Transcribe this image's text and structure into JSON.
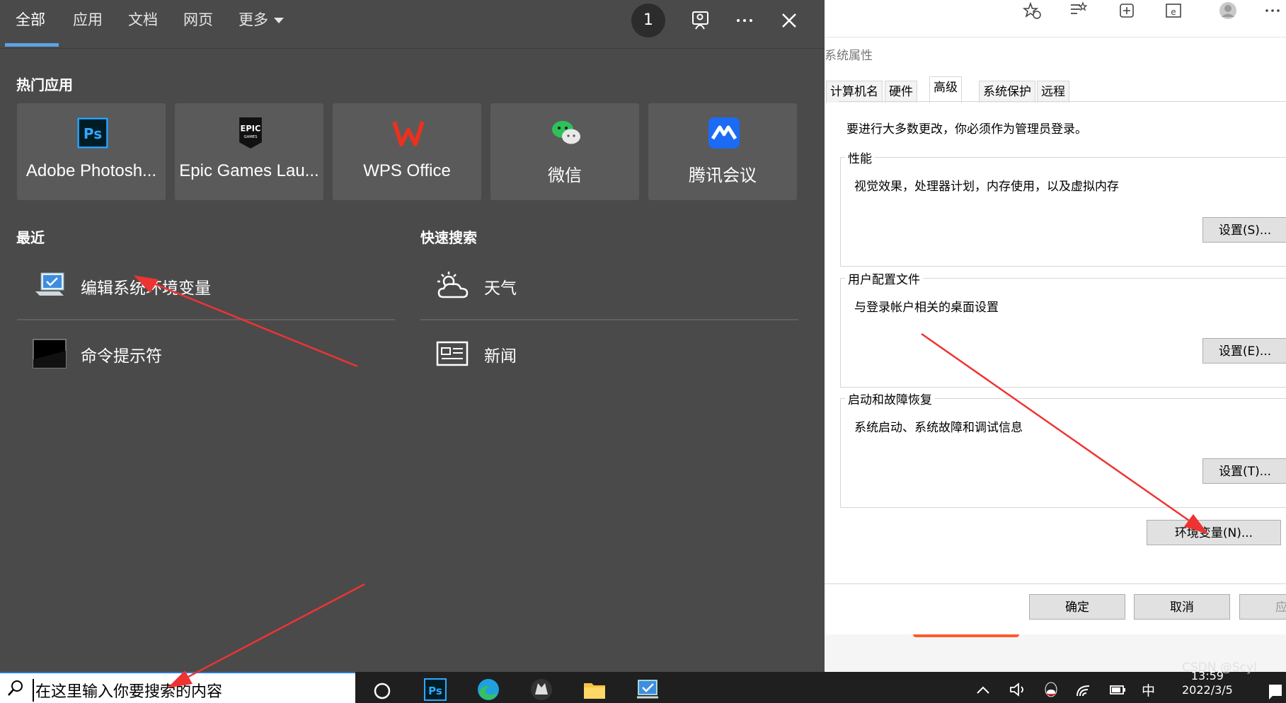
{
  "search": {
    "tabs": [
      {
        "label": "全部"
      },
      {
        "label": "应用"
      },
      {
        "label": "文档"
      },
      {
        "label": "网页"
      },
      {
        "label": "更多"
      }
    ],
    "badge_count": "1",
    "hot_apps_title": "热门应用",
    "hot_apps": [
      {
        "name": "Adobe Photosh...",
        "icon": "photoshop-icon"
      },
      {
        "name": "Epic Games Lau...",
        "icon": "epic-games-icon"
      },
      {
        "name": "WPS Office",
        "icon": "wps-office-icon"
      },
      {
        "name": "微信",
        "icon": "wechat-icon"
      },
      {
        "name": "腾讯会议",
        "icon": "tencent-meeting-icon"
      }
    ],
    "recent_title": "最近",
    "recent": [
      {
        "label": "编辑系统环境变量",
        "icon": "computer-settings-icon"
      },
      {
        "label": "命令提示符",
        "icon": "command-prompt-icon"
      }
    ],
    "quick_title": "快速搜索",
    "quick": [
      {
        "label": "天气",
        "icon": "weather-icon"
      },
      {
        "label": "新闻",
        "icon": "news-icon"
      }
    ]
  },
  "dialog": {
    "title": "系统属性",
    "tabs": [
      "计算机名",
      "硬件",
      "高级",
      "系统保护",
      "远程"
    ],
    "note": "要进行大多数更改，你必须作为管理员登录。",
    "groups": [
      {
        "legend": "性能",
        "desc": "视觉效果，处理器计划，内存使用，以及虚拟内存",
        "button": "设置(S)..."
      },
      {
        "legend": "用户配置文件",
        "desc": "与登录帐户相关的桌面设置",
        "button": "设置(E)..."
      },
      {
        "legend": "启动和故障恢复",
        "desc": "系统启动、系统故障和调试信息",
        "button": "设置(T)..."
      }
    ],
    "env_button": "环境变量(N)...",
    "ok": "确定",
    "cancel": "取消",
    "apply": "应用"
  },
  "taskbar": {
    "search_placeholder": "在这里输入你要搜索的内容",
    "ime": "中",
    "time": "13:59",
    "date": "2022/3/5",
    "watermark": "CSDN @Scyl"
  },
  "colors": {
    "flyout_bg": "#4a4a4a",
    "accent": "#5ba3e6",
    "arrow": "#ee3333"
  }
}
